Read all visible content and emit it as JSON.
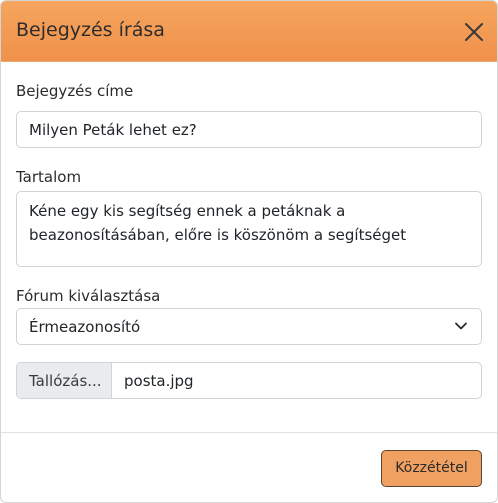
{
  "modal": {
    "title": "Bejegyzés írása",
    "close_icon": "close-icon"
  },
  "form": {
    "title_label": "Bejegyzés címe",
    "title_value": "Milyen Peták lehet ez?",
    "content_label": "Tartalom",
    "content_value": "Kéne egy kis segítség ennek a petáknak a beazonosításában, előre is köszönöm a segítséget",
    "forum_label": "Fórum kiválasztása",
    "forum_selected": "Érmeazonosító",
    "forum_icon": "chevron-down-icon",
    "file_browse_label": "Tallózás...",
    "file_name": "posta.jpg"
  },
  "footer": {
    "publish_label": "Közzététel"
  },
  "colors": {
    "header_accent": "#f0914a",
    "button_accent": "#f0a060"
  }
}
